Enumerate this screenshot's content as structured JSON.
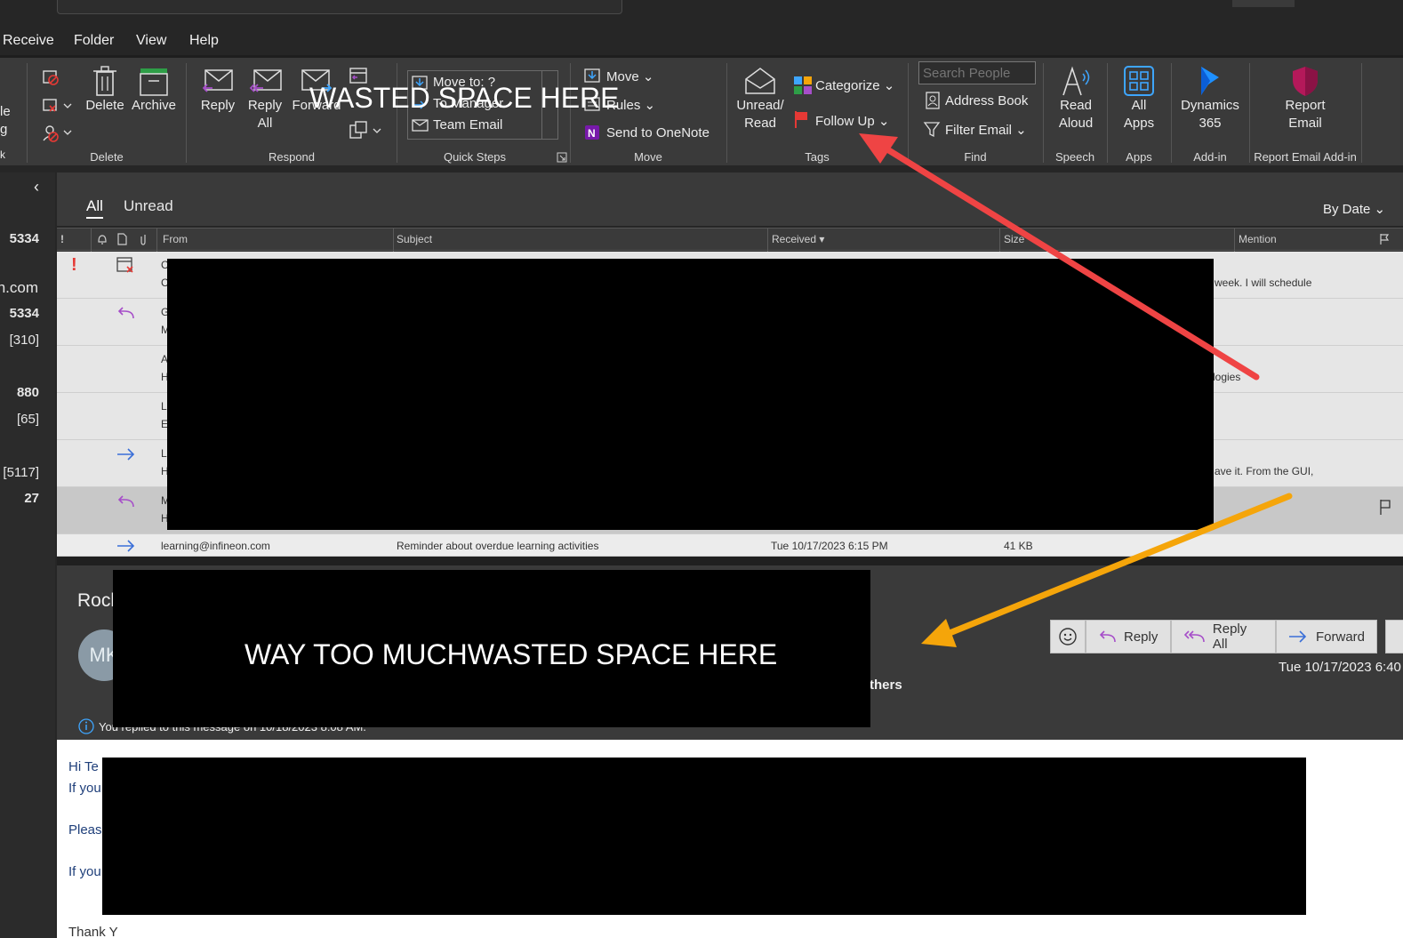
{
  "menubar": {
    "items": [
      "Receive",
      "Folder",
      "View",
      "Help"
    ]
  },
  "ribbon": {
    "left_partial": [
      "le",
      "g",
      "k"
    ],
    "delete_group": {
      "delete": "Delete",
      "archive": "Archive",
      "label": "Delete"
    },
    "respond_group": {
      "reply": "Reply",
      "reply_all_1": "Reply",
      "reply_all_2": "All",
      "forward": "Forward",
      "label": "Respond"
    },
    "quick_steps": {
      "move_to": "Move to: ?",
      "to_manager": "To Manager",
      "team_email": "Team Email",
      "label": "Quick Steps"
    },
    "move_group": {
      "move": "Move",
      "rules": "Rules",
      "onenote": "Send to OneNote",
      "label": "Move"
    },
    "tags_group": {
      "unread_1": "Unread/",
      "unread_2": "Read",
      "categorize": "Categorize",
      "follow_up": "Follow Up",
      "label": "Tags"
    },
    "find_group": {
      "search_people_placeholder": "Search People",
      "address_book": "Address Book",
      "filter_email": "Filter Email",
      "label": "Find"
    },
    "speech_group": {
      "read_1": "Read",
      "read_2": "Aloud",
      "label": "Speech"
    },
    "apps_group": {
      "all_1": "All",
      "all_2": "Apps",
      "label": "Apps"
    },
    "addin_group": {
      "dyn_1": "Dynamics",
      "dyn_2": "365",
      "label": "Add-in"
    },
    "report_group": {
      "rep_1": "Report",
      "rep_2": "Email",
      "label": "Report Email Add-in"
    }
  },
  "nav": {
    "counts": [
      "5334",
      "n.com",
      "5334",
      "[310]",
      "880",
      "[65]",
      "[5117]",
      "27"
    ]
  },
  "list": {
    "filters": {
      "all": "All",
      "unread": "Unread"
    },
    "sort": "By Date",
    "columns": {
      "importance": "!",
      "from": "From",
      "subject": "Subject",
      "received": "Received",
      "size": "Size",
      "mention": "Mention"
    },
    "rows": [
      {
        "a": "C",
        "b": "C",
        "mention": "week. I will schedule"
      },
      {
        "a": "G",
        "b": "M",
        "mention": ""
      },
      {
        "a": "A",
        "b": "H",
        "mention": "logies"
      },
      {
        "a": "L",
        "b": "E",
        "mention": ""
      },
      {
        "a": "Li",
        "b": "H",
        "mention": "ave it. From the GUI,"
      },
      {
        "a": "M",
        "b": "H",
        "mention": ""
      }
    ],
    "last_row": {
      "from": "learning@infineon.com",
      "subject": "Reminder about overdue learning activities",
      "received": "Tue 10/17/2023 6:15 PM",
      "size": "41 KB"
    }
  },
  "reading": {
    "subject_partial": "Rocl",
    "avatar": "MK",
    "recipients_partial": "thers",
    "date": "Tue 10/17/2023 6:40",
    "info": "You replied to this message on 10/18/2023 8:08 AM.",
    "buttons": {
      "reply": "Reply",
      "reply_all": "Reply All",
      "forward": "Forward"
    },
    "body_lines": [
      "Hi Te",
      "If you",
      "Pleas",
      "If you",
      "Thank Y"
    ]
  },
  "annotations": {
    "top": "WASTED SPACE HERE",
    "bottom": "WAY TOO MUCHWASTED SPACE HERE"
  },
  "colors": {
    "arrow_red": "#ef4444",
    "arrow_orange": "#f5a50a",
    "followup_flag": "#e53935",
    "onenote": "#7719aa",
    "report": "#b4195a",
    "dynamics": "#1e90ff",
    "allapps": "#3ea6ff"
  }
}
